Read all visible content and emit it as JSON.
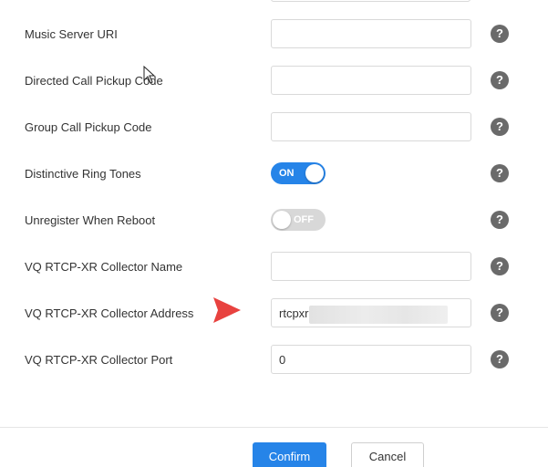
{
  "form": {
    "rows": [
      {
        "label": "Music Server URI",
        "type": "text",
        "value": "",
        "help": "?"
      },
      {
        "label": "Directed Call Pickup Code",
        "type": "text",
        "value": "",
        "help": "?"
      },
      {
        "label": "Group Call Pickup Code",
        "type": "text",
        "value": "",
        "help": "?"
      },
      {
        "label": "Distinctive Ring Tones",
        "type": "toggle",
        "state": "ON",
        "help": "?"
      },
      {
        "label": "Unregister When Reboot",
        "type": "toggle",
        "state": "OFF",
        "help": "?"
      },
      {
        "label": "VQ RTCP-XR Collector Name",
        "type": "text",
        "value": "",
        "help": "?"
      },
      {
        "label": "VQ RTCP-XR Collector Address",
        "type": "text",
        "value": "rtcpxr(",
        "help": "?"
      },
      {
        "label": "VQ RTCP-XR Collector Port",
        "type": "text",
        "value": "0",
        "help": "?"
      }
    ]
  },
  "footer": {
    "confirm_label": "Confirm",
    "cancel_label": "Cancel"
  },
  "colors": {
    "accent": "#2684e8",
    "toggle_off": "#d8d8d8",
    "help_icon": "#6a6a6a",
    "annotation_arrow": "#e8423f"
  },
  "icons": {
    "help": "question-mark-circle-icon",
    "annotation": "red-arrow-icon",
    "cursor": "mouse-pointer-icon"
  }
}
